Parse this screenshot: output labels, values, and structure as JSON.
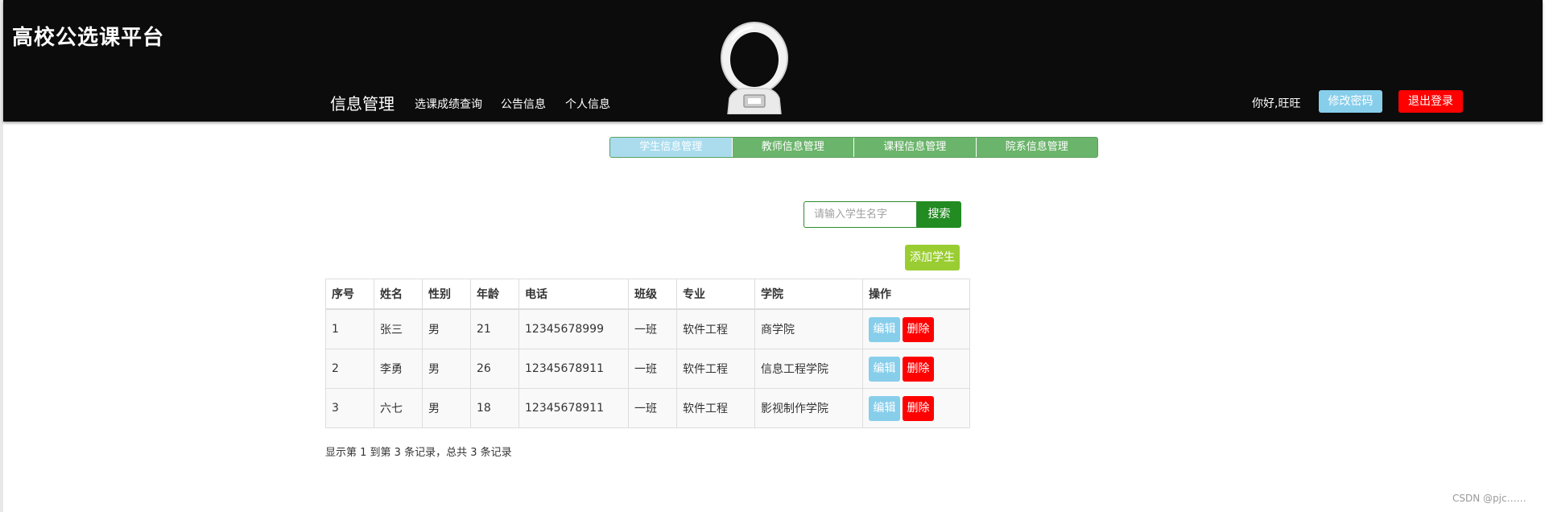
{
  "header": {
    "brand": "高校公选课平台",
    "nav_main": "信息管理",
    "nav_items": [
      "选课成绩查询",
      "公告信息",
      "个人信息"
    ],
    "greeting": "你好,旺旺",
    "change_password": "修改密码",
    "logout": "退出登录"
  },
  "subnav": {
    "items": [
      "学生信息管理",
      "教师信息管理",
      "课程信息管理",
      "院系信息管理"
    ],
    "active": 0
  },
  "search": {
    "placeholder": "请输入学生名字",
    "value": "",
    "button": "搜索"
  },
  "add_button": "添加学生",
  "table": {
    "columns": [
      "序号",
      "姓名",
      "性别",
      "年龄",
      "电话",
      "班级",
      "专业",
      "学院",
      "操作"
    ],
    "rows": [
      [
        "1",
        "张三",
        "男",
        "21",
        "12345678999",
        "一班",
        "软件工程",
        "商学院"
      ],
      [
        "2",
        "李勇",
        "男",
        "26",
        "12345678911",
        "一班",
        "软件工程",
        "信息工程学院"
      ],
      [
        "3",
        "六七",
        "男",
        "18",
        "12345678911",
        "一班",
        "软件工程",
        "影视制作学院"
      ]
    ],
    "edit_label": "编辑",
    "delete_label": "删除"
  },
  "pagination_info": "显示第 1 到第 3 条记录，总共 3 条记录",
  "watermark": "CSDN @pjc……",
  "colors": {
    "header_bg": "#0c0c0c",
    "subnav_bg": "#6bb46b",
    "subnav_active": "#aadcee",
    "search_button": "#228b22",
    "add_button": "#9acd32",
    "edit_button": "#87ceeb",
    "delete_button": "#ff0000",
    "change_password_button": "#87ceeb",
    "logout_button": "#ff0000"
  }
}
